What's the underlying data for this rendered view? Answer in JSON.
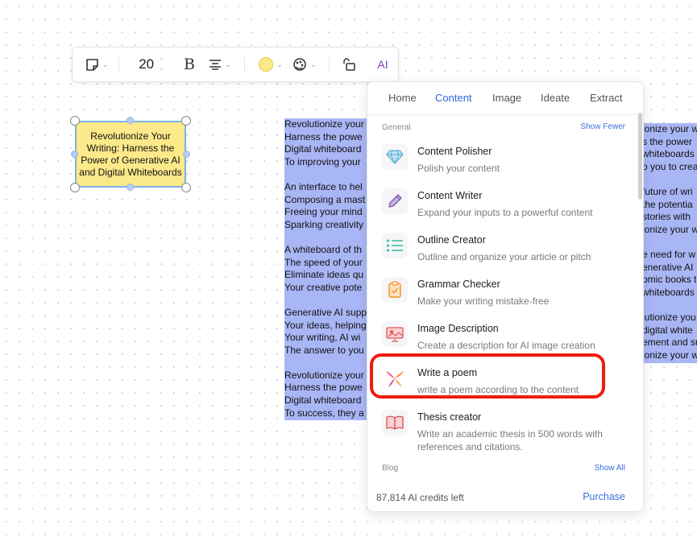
{
  "toolbar": {
    "font_size": "20",
    "ai_label": "AI"
  },
  "sticky": {
    "text": "Revolutionize Your Writing: Harness the Power of Generative AI and Digital Whiteboards"
  },
  "left_text": [
    "Revolutionize your",
    "Harness the powe",
    "Digital whiteboard",
    "To improving your",
    "",
    "An interface to hel",
    "Composing a mast",
    "Freeing your mind",
    "Sparking creativity",
    "",
    "A whiteboard of th",
    "The speed of your",
    "Eliminate ideas qu",
    "Your creative pote",
    "",
    "Generative AI supp",
    "Your ideas, helping",
    "Your writing, AI wi",
    "The answer to you",
    "",
    "Revolutionize your",
    "Harness the powe",
    "Digital whiteboard",
    "To success, they a"
  ],
  "right_text": [
    "ionize your w",
    "s the power",
    "whiteboards",
    "o you to crea",
    "",
    "future of wri",
    "the potentia",
    "stories with",
    "ionize your w",
    "",
    "e need for w",
    "enerative AI",
    "omic books t",
    "whiteboards",
    "",
    "lutionize you",
    "digital white",
    "ement and su",
    "ionize your w"
  ],
  "panel": {
    "tabs": [
      "Home",
      "Content",
      "Image",
      "Ideate",
      "Extract"
    ],
    "active_tab": "Content",
    "general_label": "General",
    "show_fewer": "Show Fewer",
    "items": [
      {
        "title": "Content Polisher",
        "desc": "Polish your content",
        "icon": "diamond-icon"
      },
      {
        "title": "Content Writer",
        "desc": "Expand your inputs to a powerful content",
        "icon": "pen-icon"
      },
      {
        "title": "Outline Creator",
        "desc": "Outline and organize your article or pitch",
        "icon": "list-icon"
      },
      {
        "title": "Grammar Checker",
        "desc": "Make your writing mistake-free",
        "icon": "clipboard-check-icon"
      },
      {
        "title": "Image Description",
        "desc": "Create a description for AI image creation",
        "icon": "image-presentation-icon"
      },
      {
        "title": "Write a poem",
        "desc": "write a poem according to the content",
        "icon": "poem-icon"
      },
      {
        "title": "Thesis creator",
        "desc": "Write an academic thesis in 500 words with references and citations.",
        "icon": "book-icon"
      }
    ],
    "blog_label": "Blog",
    "show_all": "Show All",
    "credits": "87,814 AI credits left",
    "purchase": "Purchase"
  },
  "colors": {
    "accent": "#2f66d9",
    "selection": "#a9b6f5",
    "sticky": "#fbe98a",
    "highlight": "#f01c10"
  }
}
